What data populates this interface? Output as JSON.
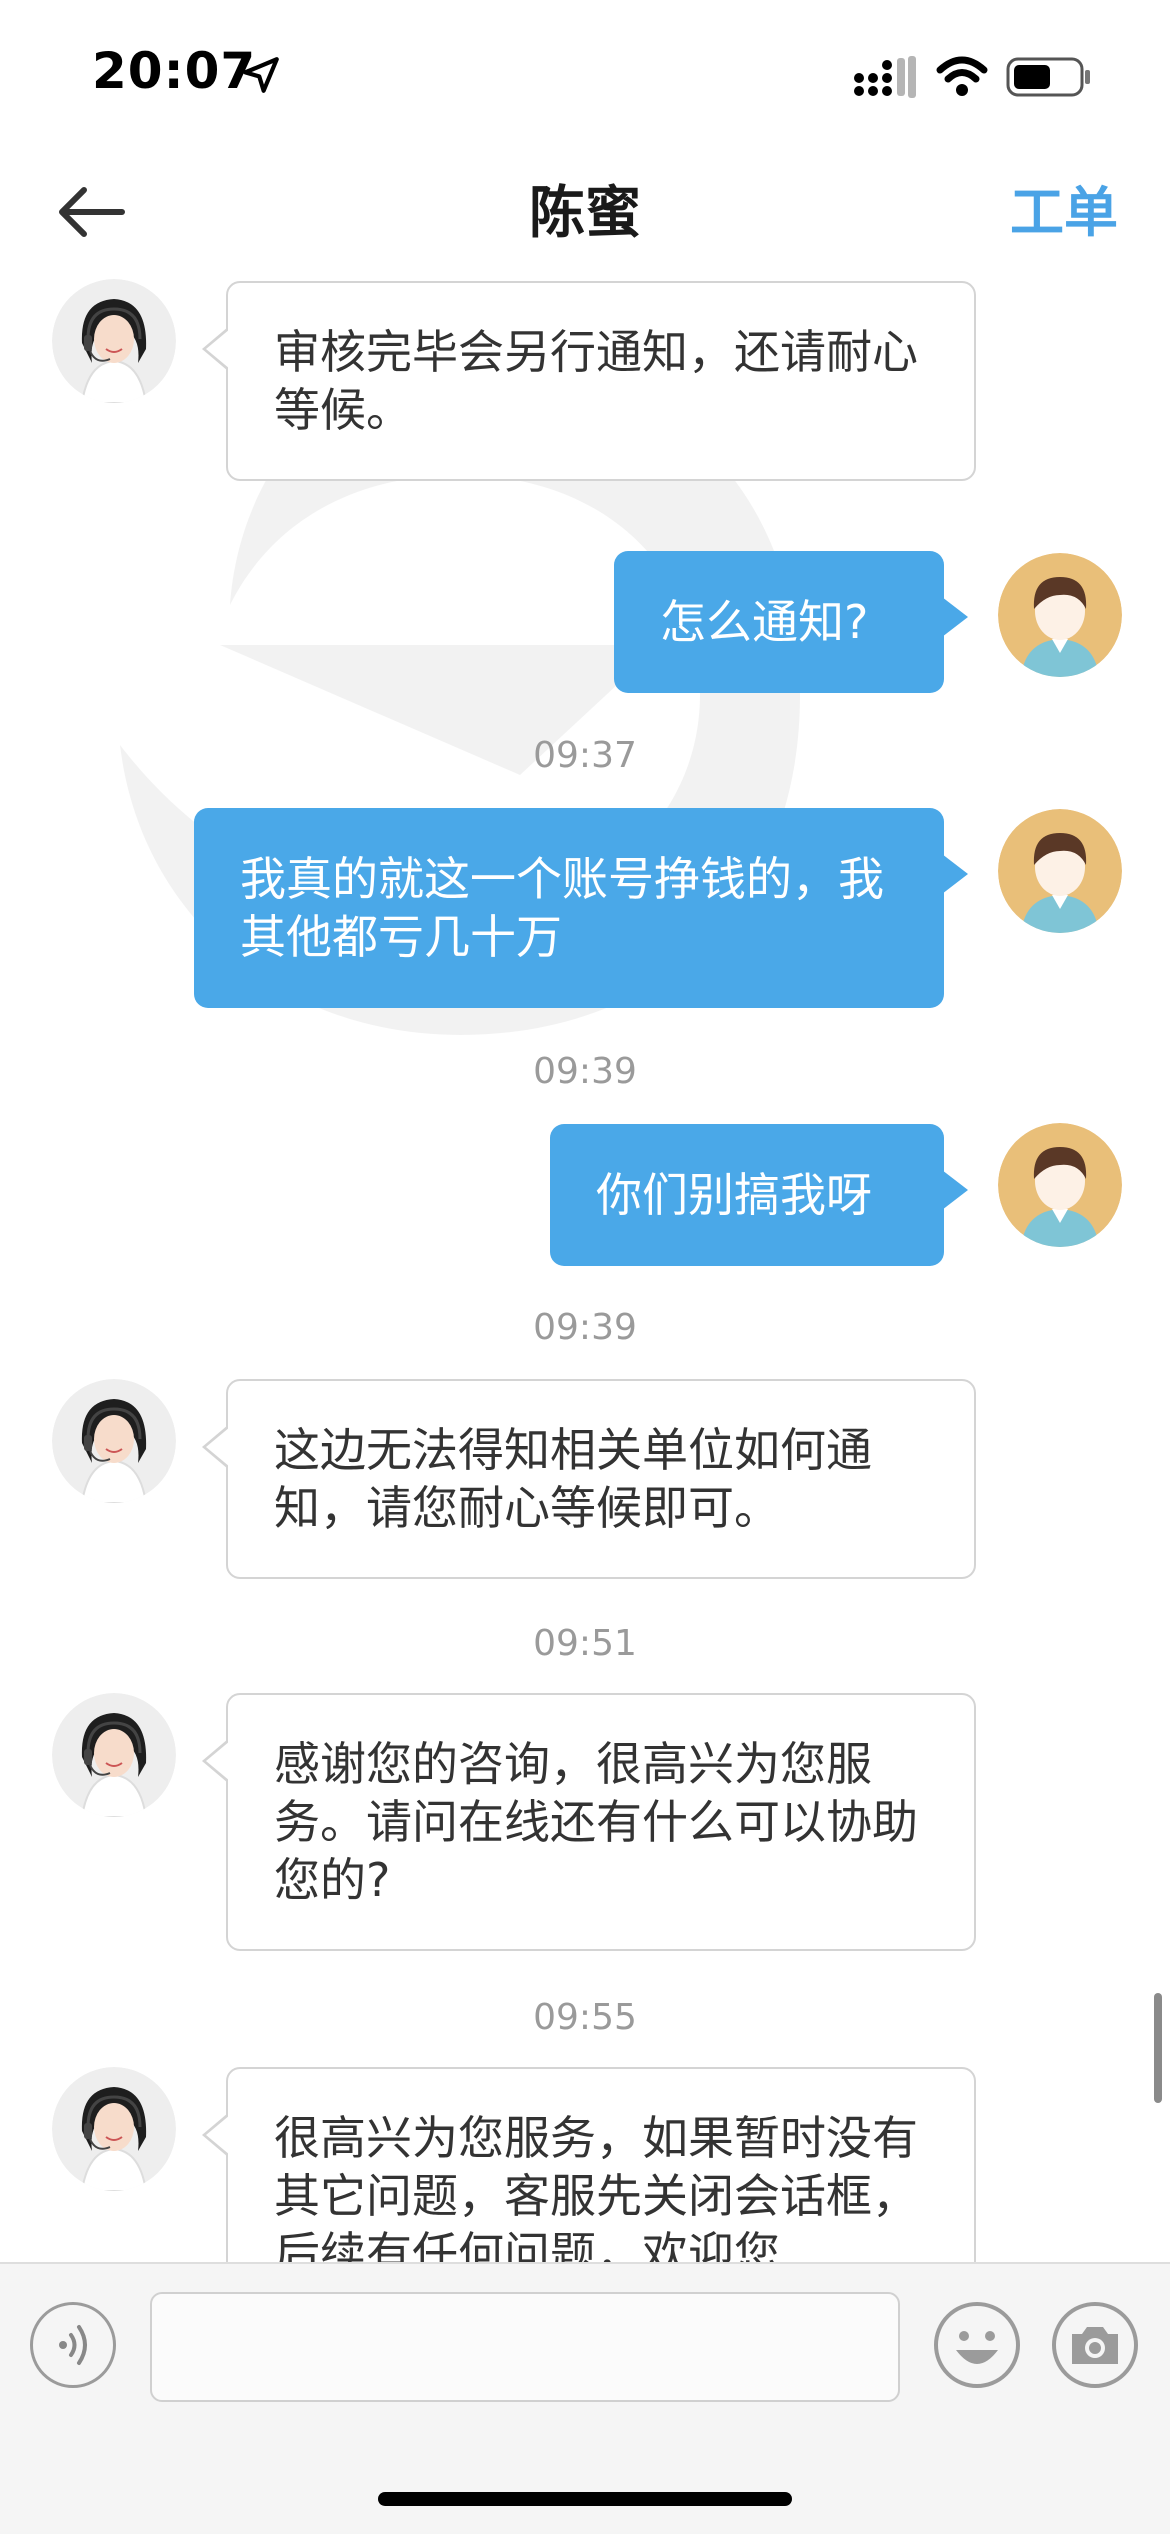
{
  "status_bar": {
    "time": "20:07"
  },
  "nav": {
    "title": "陈蜜",
    "action_label": "工单"
  },
  "chat": {
    "messages": [
      {
        "sender": "agent",
        "text": "审核完毕会另行通知，还请耐心等候。"
      },
      {
        "sender": "user",
        "text": "怎么通知?"
      },
      {
        "type": "timestamp",
        "text": "09:37"
      },
      {
        "sender": "user",
        "text": "我真的就这一个账号挣钱的，我其他都亏几十万"
      },
      {
        "type": "timestamp",
        "text": "09:39"
      },
      {
        "sender": "user",
        "text": "你们别搞我呀"
      },
      {
        "type": "timestamp",
        "text": "09:39"
      },
      {
        "sender": "agent",
        "text": "这边无法得知相关单位如何通知，请您耐心等候即可。"
      },
      {
        "type": "timestamp",
        "text": "09:51"
      },
      {
        "sender": "agent",
        "text": "感谢您的咨询，很高兴为您服务。请问在线还有什么可以协助您的?"
      },
      {
        "type": "timestamp",
        "text": "09:55"
      },
      {
        "sender": "agent",
        "text": "很高兴为您服务，如果暂时没有其它问题，客服先关闭会话框，后续有任何问题，欢迎您"
      }
    ]
  },
  "input_bar": {
    "message_value": ""
  },
  "colors": {
    "accent": "#4aa3e6",
    "user_bubble": "#4aa8e8",
    "timestamp": "#9a9a9a"
  }
}
